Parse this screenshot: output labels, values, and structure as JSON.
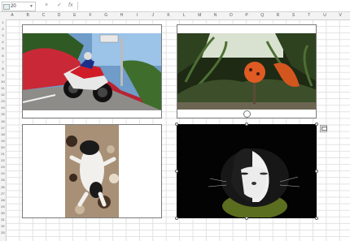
{
  "formula_bar": {
    "name_box": "20",
    "cancel_icon": "×",
    "enter_icon": "✓",
    "fx_label": "fx",
    "formula_value": ""
  },
  "columns": [
    "A",
    "B",
    "C",
    "D",
    "E",
    "F",
    "G",
    "H",
    "I",
    "J",
    "K",
    "L",
    "M",
    "N",
    "O",
    "P",
    "Q",
    "R",
    "S",
    "T",
    "U",
    "V"
  ],
  "rows": [
    "1",
    "2",
    "3",
    "4",
    "5",
    "6",
    "7",
    "8",
    "9",
    "10",
    "11",
    "12",
    "13",
    "14",
    "15",
    "16",
    "17",
    "18",
    "19",
    "20",
    "21",
    "22",
    "23",
    "24",
    "25",
    "26",
    "27",
    "28",
    "29",
    "30",
    "31",
    "32",
    "33"
  ],
  "images": [
    {
      "subject": "motorcycle-roadside-flowers"
    },
    {
      "subject": "orange-lily-forest"
    },
    {
      "subject": "cat-lying-on-back"
    },
    {
      "subject": "cat-face-dark"
    }
  ],
  "colors": {
    "accent": "#217346",
    "selection": "#666666"
  }
}
